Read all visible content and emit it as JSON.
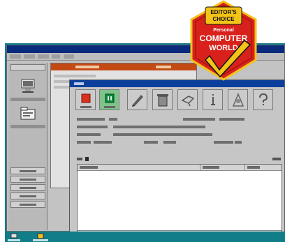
{
  "badge": {
    "line1": "EDITOR'S",
    "line2": "CHOICE",
    "line3": "Personal",
    "line4": "Computer",
    "line5": "World",
    "colors": {
      "red": "#d9211c",
      "gold": "#f3c318",
      "black": "#111111",
      "white": "#ffffff"
    }
  },
  "colors": {
    "desktop": "#0b7d86",
    "window_titlebar": "#0a2a7c",
    "list_titlebar": "#c34a12",
    "dialog_titlebar": "#0c3f9c",
    "stop_icon": "#d8301c",
    "start_icon": "#0e8a3c"
  },
  "dialog": {
    "toolbar_icons": [
      "stop-icon",
      "start-icon",
      "pen-icon",
      "bin-icon",
      "hand-icon",
      "info-icon",
      "settings-icon",
      "help-icon"
    ],
    "progress": 0.02
  }
}
